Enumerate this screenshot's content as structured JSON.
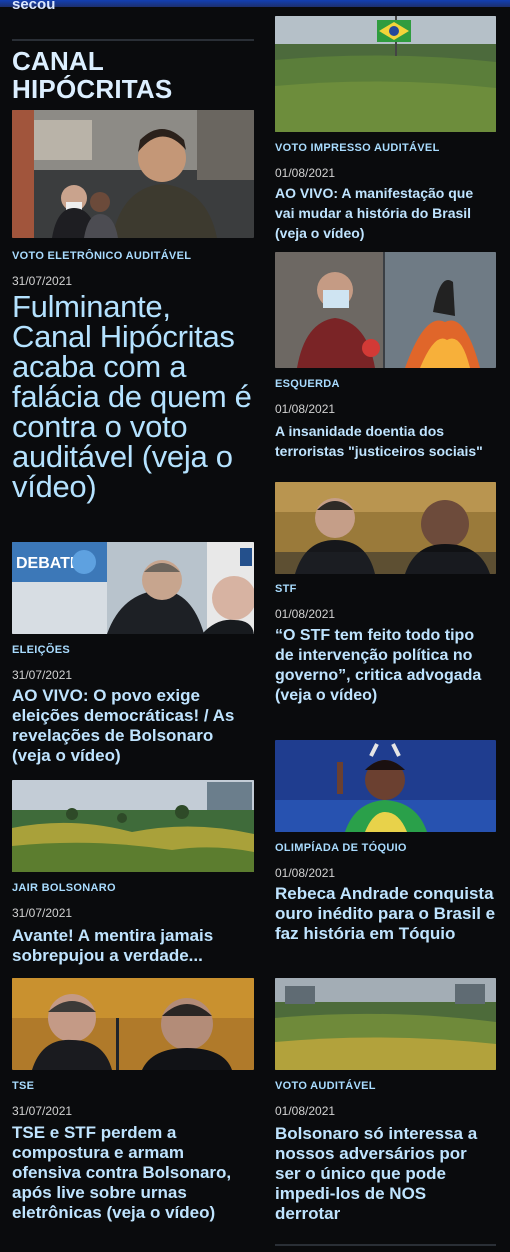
{
  "header": {
    "cut_text": "secou"
  },
  "section": {
    "title": "CANAL HIPÓCRITAS"
  },
  "left_articles": [
    {
      "category": "VOTO ELETRÔNICO AUDITÁVEL",
      "date": "31/07/2021",
      "title": "Fulminante, Canal Hipócritas acaba com a falácia de quem é contra o voto auditável (veja o vídeo)",
      "image": "man-speaking-photo"
    },
    {
      "category": "ELEIÇÕES",
      "date": "31/07/2021",
      "title": "AO VIVO: O povo exige eleições democráticas! / As revelações de Bolsonaro (veja o vídeo)",
      "image": "debate-judges-photo"
    },
    {
      "category": "JAIR BOLSONARO",
      "date": "31/07/2021",
      "title": "Avante! A mentira jamais sobrepujou a verdade...",
      "image": "crowd-esplanada-photo"
    },
    {
      "category": "TSE",
      "date": "31/07/2021",
      "title": "TSE e STF perdem a compostura e armam ofensiva contra Bolsonaro, após live sobre urnas eletrônicas (veja o vídeo)",
      "image": "ministers-talking-photo"
    }
  ],
  "right_articles": [
    {
      "category": "VOTO IMPRESSO AUDITÁVEL",
      "date": "01/08/2021",
      "title": "AO VIVO: A manifestação que vai mudar a história do Brasil (veja o vídeo)",
      "image": "flag-crowd-photo"
    },
    {
      "category": "ESQUERDA",
      "date": "01/08/2021",
      "title": "A insanidade doentia dos terroristas \"justiceiros sociais\"",
      "image": "fire-protest-photo"
    },
    {
      "category": "STF",
      "date": "01/08/2021",
      "title": "“O STF tem feito todo tipo de intervenção política no governo”, critica advogada (veja o vídeo)",
      "image": "stf-session-photo"
    },
    {
      "category": "OLIMPÍADA DE TÓQUIO",
      "date": "01/08/2021",
      "title": "Rebeca Andrade conquista ouro inédito para o Brasil e faz história em Tóquio",
      "image": "gymnast-photo"
    },
    {
      "category": "VOTO AUDITÁVEL",
      "date": "01/08/2021",
      "title": "Bolsonaro só interessa a nossos adversários por ser o único que pode impedi-los de NOS derrotar",
      "image": "street-crowd-photo"
    }
  ],
  "colors": {
    "background": "#0a0b0d",
    "category": "#a9dcff",
    "title": "#bfe4ff",
    "accent_bar": "#123fb3"
  }
}
